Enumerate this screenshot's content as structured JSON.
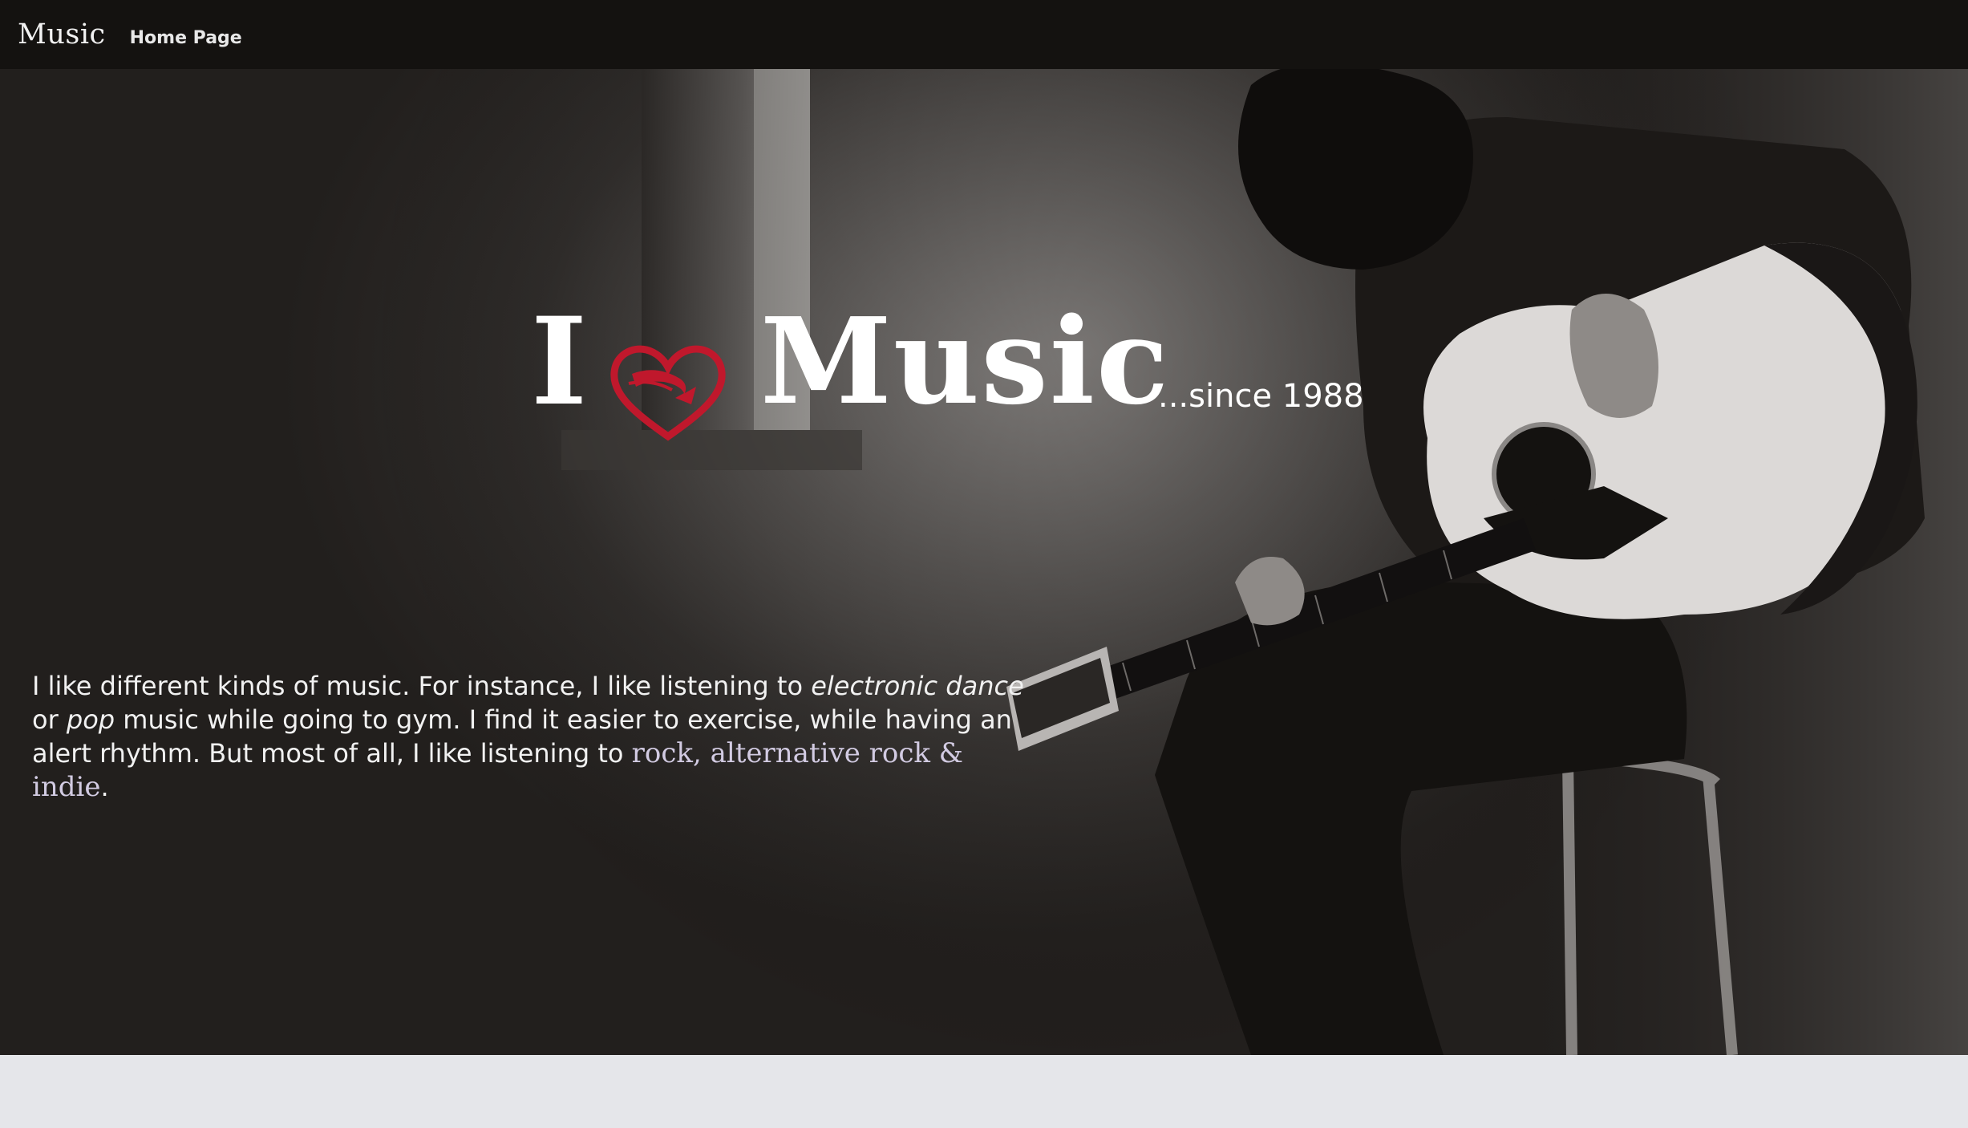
{
  "navbar": {
    "brand": "Music",
    "links": [
      {
        "label": "Home Page"
      }
    ]
  },
  "hero": {
    "headline": {
      "word_i": "I",
      "heart_icon": "heart-icon",
      "word_music": "Music",
      "since": "...since 1988"
    },
    "intro": {
      "part1": "I like different kinds of music. For instance, I like listening to ",
      "em1": "electronic dance",
      "part2": " or ",
      "em2": "pop",
      "part3": " music while going to gym. I find it easier to exercise, while having an alert rhythm. But most of all, I like listening to ",
      "fancy": "rock, alternative rock & indie",
      "part4": "."
    }
  },
  "colors": {
    "navbar_bg": "#141210",
    "hero_bg": "#221f1d",
    "footer_bg": "#e5e6ea",
    "heart": "#c0182c",
    "fancy_text": "#d2cbe2"
  }
}
